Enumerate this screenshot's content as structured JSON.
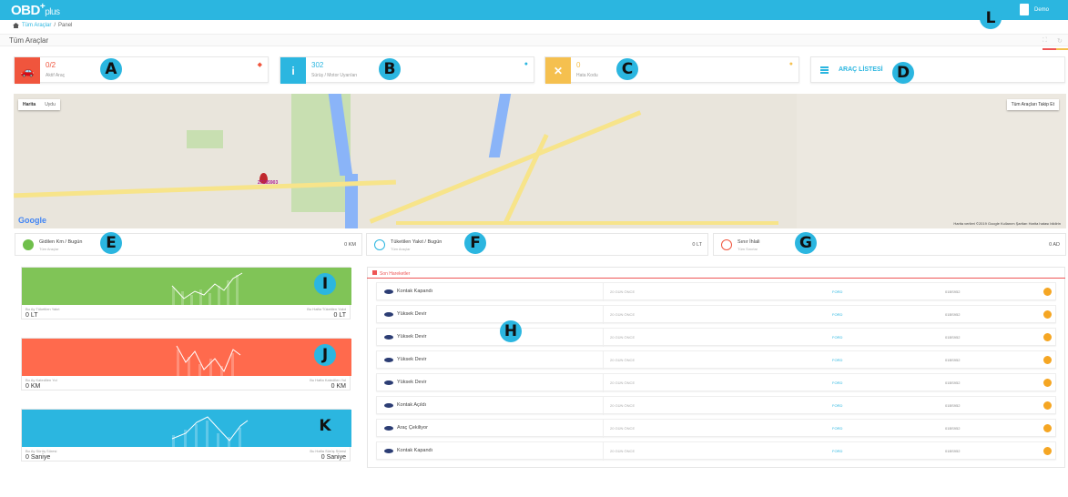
{
  "header": {
    "logo_main": "OBD",
    "logo_sup": "+",
    "logo_sub": "plus",
    "user": "Demo"
  },
  "breadcrumb": {
    "home": "Tüm Araçlar",
    "sep": "/",
    "current": "Panel"
  },
  "page_title": "Tüm Araçlar",
  "stats": [
    {
      "value": "0/2",
      "label": "Aktif Araç",
      "color": "#f0553d"
    },
    {
      "value": "302",
      "label": "Sürüş / Motor Uyarıları",
      "color": "#2bb6e0"
    },
    {
      "value": "0",
      "label": "Hata Kodu",
      "color": "#f5c04f"
    }
  ],
  "vehicle_list": "ARAÇ LİSTESİ",
  "map": {
    "type_buttons": [
      "Harita",
      "Uydu"
    ],
    "follow_all": "Tüm Araçları Takip Et",
    "pin_label": "27185903",
    "google": "Google",
    "attribution": "Harita verileri ©2019 Google   Kullanım Şartları   Harita hatası bildirin"
  },
  "kpis": [
    {
      "title": "Gidilen Km / Bugün",
      "sub": "Tüm Araçlar",
      "value": "0 KM",
      "color": "#6fbf4b"
    },
    {
      "title": "Tüketilen Yakıt / Bugün",
      "sub": "Tüm Araçlar",
      "value": "0 LT",
      "color": "#2bb6e0"
    },
    {
      "title": "Sınır İhlali",
      "sub": "Tüm Sınırlar",
      "value": "0 AD",
      "color": "#f0553d"
    }
  ],
  "cards": [
    {
      "color": "#80c457",
      "left_label": "Bu Ay Tüketilen Yakıt",
      "left_value": "0 LT",
      "right_label": "Bu Hafta Tüketilen Yakıt",
      "right_value": "0 LT"
    },
    {
      "color": "#ff6a4d",
      "left_label": "Bu Ay Katedilen Yol",
      "left_value": "0 KM",
      "right_label": "Bu Hafta Katedilen Yol",
      "right_value": "0 KM"
    },
    {
      "color": "#2bb6e0",
      "left_label": "Bu Ay Sürüş Süresi",
      "left_value": "0 Saniye",
      "right_label": "Bu Hafta Sürüş Süresi",
      "right_value": "0 Saniye"
    }
  ],
  "activities": {
    "title": "Son Hareketler",
    "rows": [
      {
        "event": "Kontak Kapandı",
        "time": "20 GÜN ÖNCE",
        "model": "FORD",
        "plate": "01BS952"
      },
      {
        "event": "Yüksek Devir",
        "time": "20 GÜN ÖNCE",
        "model": "FORD",
        "plate": "01BS952"
      },
      {
        "event": "Yüksek Devir",
        "time": "20 GÜN ÖNCE",
        "model": "FORD",
        "plate": "01BS952"
      },
      {
        "event": "Yüksek Devir",
        "time": "20 GÜN ÖNCE",
        "model": "FORD",
        "plate": "01BS952"
      },
      {
        "event": "Yüksek Devir",
        "time": "20 GÜN ÖNCE",
        "model": "FORD",
        "plate": "01BS952"
      },
      {
        "event": "Kontak Açıldı",
        "time": "20 GÜN ÖNCE",
        "model": "FORD",
        "plate": "01BS952"
      },
      {
        "event": "Araç Çekiliyor",
        "time": "20 GÜN ÖNCE",
        "model": "FORD",
        "plate": "01BS952"
      },
      {
        "event": "Kontak Kapandı",
        "time": "20 GÜN ÖNCE",
        "model": "FORD",
        "plate": "01BS952"
      }
    ]
  },
  "callouts": [
    "A",
    "B",
    "C",
    "D",
    "E",
    "F",
    "G",
    "H",
    "I",
    "J",
    "K",
    "L"
  ]
}
